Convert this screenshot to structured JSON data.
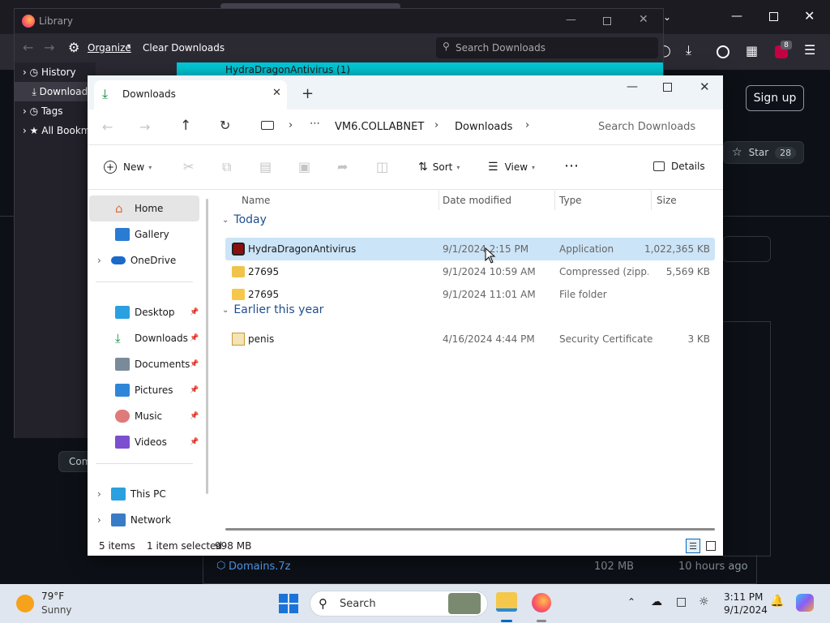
{
  "browser": {
    "signup_label": "Sign up",
    "star_label": "Star",
    "star_count": "28",
    "comment_label": "Com",
    "release_asset_name": "Domains.7z",
    "release_asset_size": "102 MB",
    "release_asset_time": "10 hours ago",
    "badge_count": "8"
  },
  "library": {
    "title": "Library",
    "organize_label": "Organize",
    "clear_label": "Clear Downloads",
    "search_placeholder": "Search Downloads",
    "sidebar": [
      {
        "label": "History",
        "icon": "clock-icon"
      },
      {
        "label": "Downloads",
        "icon": "download-icon"
      },
      {
        "label": "Tags",
        "icon": "tag-icon"
      },
      {
        "label": "All Bookmarks",
        "icon": "star-icon"
      }
    ],
    "banner_text": "HydraDragonAntivirus (1)"
  },
  "explorer": {
    "tab_title": "Downloads",
    "breadcrumb": {
      "computer": "VM6.COLLABNET",
      "folder": "Downloads"
    },
    "search_placeholder": "Search Downloads",
    "commands": {
      "new": "New",
      "sort": "Sort",
      "view": "View",
      "details": "Details"
    },
    "nav": {
      "home": "Home",
      "gallery": "Gallery",
      "onedrive": "OneDrive",
      "desktop": "Desktop",
      "downloads": "Downloads",
      "documents": "Documents",
      "pictures": "Pictures",
      "music": "Music",
      "videos": "Videos",
      "thispc": "This PC",
      "network": "Network"
    },
    "columns": {
      "name": "Name",
      "date": "Date modified",
      "type": "Type",
      "size": "Size"
    },
    "groups": {
      "today": "Today",
      "earlier": "Earlier this year"
    },
    "files": [
      {
        "name": "HydraDragonAntivirus",
        "date": "9/1/2024 2:15 PM",
        "type": "Application",
        "size": "1,022,365 KB",
        "icon": "app-icon",
        "selected": true
      },
      {
        "name": "27695",
        "date": "9/1/2024 10:59 AM",
        "type": "Compressed (zipp...",
        "size": "5,569 KB",
        "icon": "zip-folder-icon",
        "selected": false
      },
      {
        "name": "27695",
        "date": "9/1/2024 11:01 AM",
        "type": "File folder",
        "size": "",
        "icon": "folder-icon",
        "selected": false
      },
      {
        "name": "penis",
        "date": "4/16/2024 4:44 PM",
        "type": "Security Certificate",
        "size": "3 KB",
        "icon": "certificate-icon",
        "selected": false
      }
    ],
    "status": {
      "items": "5 items",
      "selected": "1 item selected",
      "size": "998 MB"
    }
  },
  "taskbar": {
    "weather_temp": "79°F",
    "weather_desc": "Sunny",
    "search_label": "Search",
    "time": "3:11 PM",
    "date": "9/1/2024"
  },
  "colors": {
    "accent": "#0067c0",
    "selection": "#cce4f7",
    "firefox_dark": "#1c1b22",
    "banner": "#00c8d7"
  }
}
